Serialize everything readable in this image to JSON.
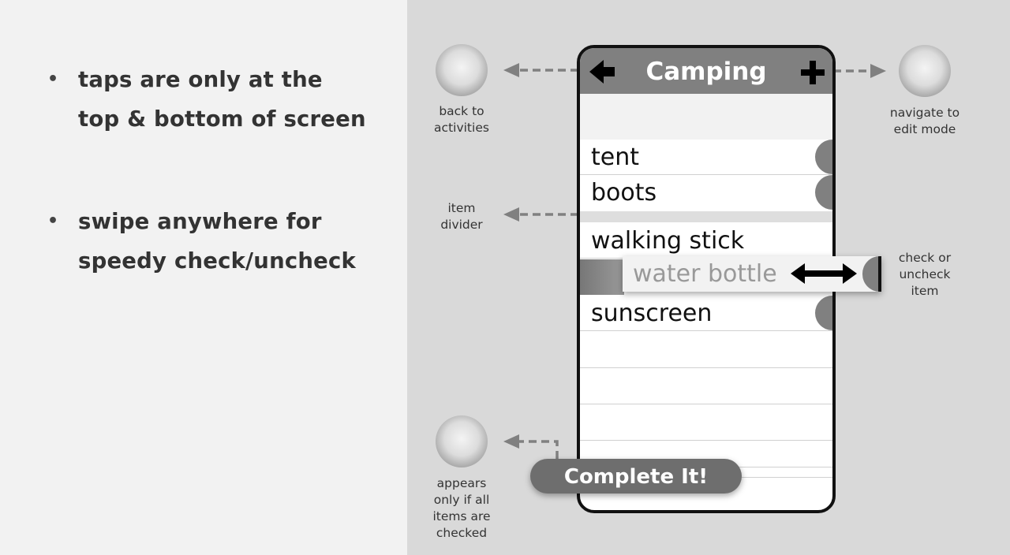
{
  "bullets": [
    {
      "line1": "taps are only at the",
      "line2": "top & bottom of screen"
    },
    {
      "line1": "swipe anywhere for",
      "line2": "speedy check/uncheck"
    }
  ],
  "phone": {
    "title": "Camping",
    "items": [
      "tent",
      "boots",
      "walking stick",
      "water bottle",
      "sunscreen"
    ],
    "complete_button": "Complete It!"
  },
  "annotations": {
    "back": [
      "back to",
      "activities"
    ],
    "edit": [
      "navigate to",
      "edit mode"
    ],
    "divider": [
      "item",
      "divider"
    ],
    "check": [
      "check or",
      "uncheck",
      "item"
    ],
    "complete": [
      "appears",
      "only if all",
      "items are",
      "checked"
    ]
  },
  "icons": {
    "back": "left-arrow-icon",
    "add": "plus-icon",
    "swap": "double-arrow-icon",
    "tap_target": "touch-circle-icon"
  },
  "colors": {
    "header": "#808080",
    "right_panel": "#d9d9d9",
    "left_panel": "#f2f2f2",
    "button": "#6e6e6e"
  }
}
